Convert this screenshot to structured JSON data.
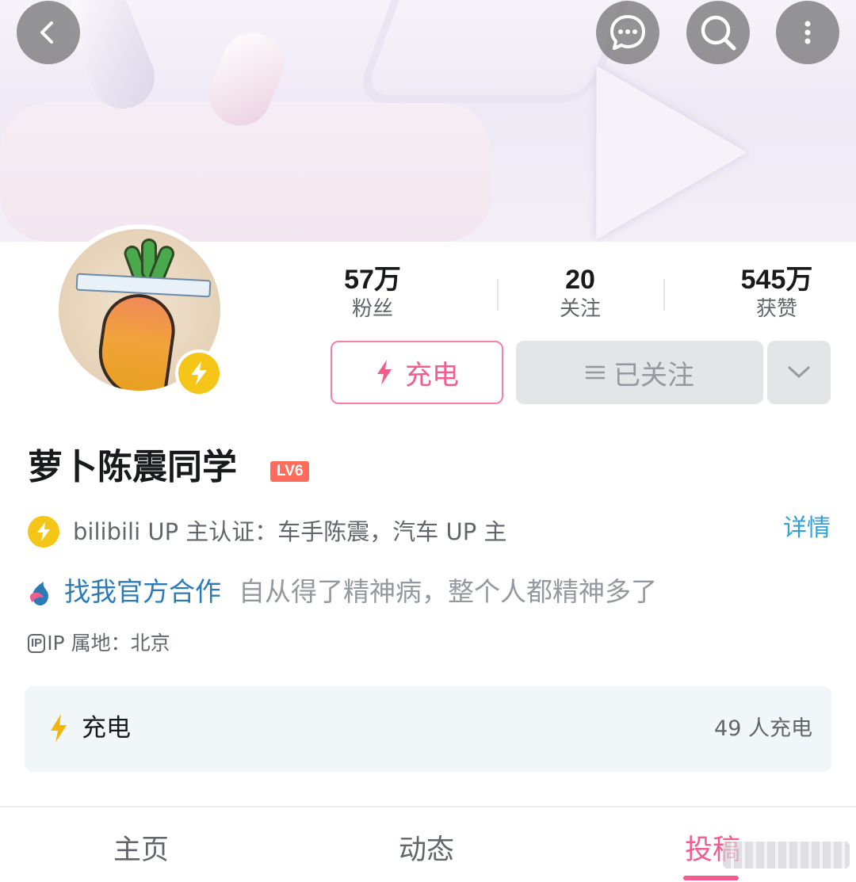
{
  "profile": {
    "name": "萝卜陈震同学",
    "level": "LV6",
    "stats": [
      {
        "value": "57万",
        "label": "粉丝"
      },
      {
        "value": "20",
        "label": "关注"
      },
      {
        "value": "545万",
        "label": "获赞"
      }
    ],
    "certification": "bilibili UP 主认证：车手陈震，汽车 UP 主",
    "cert_detail_link": "详情",
    "cooperation_link": "找我官方合作",
    "signature": "自从得了精神病，整个人都精神多了",
    "ip_badge": "IP",
    "ip_location": "IP 属地：北京"
  },
  "actions": {
    "charge_label": "充电",
    "follow_label": "已关注"
  },
  "charge_card": {
    "title": "充电",
    "count": "49 人充电"
  },
  "tabs": [
    {
      "label": "主页",
      "active": false
    },
    {
      "label": "动态",
      "active": false
    },
    {
      "label": "投稿",
      "active": true
    }
  ],
  "icons": [
    "back-icon",
    "message-icon",
    "search-icon",
    "more-icon",
    "lightning-icon",
    "menu-lines-icon",
    "chevron-down-icon",
    "cooperation-logo-icon"
  ],
  "colors": {
    "accent_pink": "#f25d8e",
    "link_blue": "#2b7bb9",
    "detail_blue": "#2fa3d9",
    "verified_yellow": "#f5c518",
    "level_red": "#ff6c5c"
  }
}
